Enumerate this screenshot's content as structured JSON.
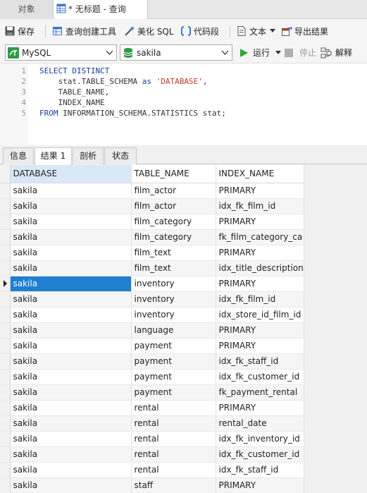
{
  "tabs": {
    "objects_label": "对象",
    "query_label": "* 无标题 - 查询"
  },
  "toolbar1": {
    "save_label": "保存",
    "query_builder_label": "查询创建工具",
    "beautify_label": "美化 SQL",
    "code_snippet_label": "代码段",
    "text_label": "文本",
    "export_label": "导出结果"
  },
  "toolbar2": {
    "connection": "MySQL",
    "database": "sakila",
    "run_label": "运行",
    "stop_label": "停止",
    "explain_label": "解释"
  },
  "editor": {
    "line_numbers": [
      "1",
      "2",
      "3",
      "4",
      "5"
    ]
  },
  "result_tabs": [
    "信息",
    "结果 1",
    "剖析",
    "状态"
  ],
  "grid": {
    "columns": [
      "DATABASE",
      "TABLE_NAME",
      "INDEX_NAME"
    ],
    "rows": [
      [
        "sakila",
        "film_actor",
        "PRIMARY"
      ],
      [
        "sakila",
        "film_actor",
        "idx_fk_film_id"
      ],
      [
        "sakila",
        "film_category",
        "PRIMARY"
      ],
      [
        "sakila",
        "film_category",
        "fk_film_category_ca"
      ],
      [
        "sakila",
        "film_text",
        "PRIMARY"
      ],
      [
        "sakila",
        "film_text",
        "idx_title_description"
      ],
      [
        "sakila",
        "inventory",
        "PRIMARY"
      ],
      [
        "sakila",
        "inventory",
        "idx_fk_film_id"
      ],
      [
        "sakila",
        "inventory",
        "idx_store_id_film_id"
      ],
      [
        "sakila",
        "language",
        "PRIMARY"
      ],
      [
        "sakila",
        "payment",
        "PRIMARY"
      ],
      [
        "sakila",
        "payment",
        "idx_fk_staff_id"
      ],
      [
        "sakila",
        "payment",
        "idx_fk_customer_id"
      ],
      [
        "sakila",
        "payment",
        "fk_payment_rental"
      ],
      [
        "sakila",
        "rental",
        "PRIMARY"
      ],
      [
        "sakila",
        "rental",
        "rental_date"
      ],
      [
        "sakila",
        "rental",
        "idx_fk_inventory_id"
      ],
      [
        "sakila",
        "rental",
        "idx_fk_customer_id"
      ],
      [
        "sakila",
        "rental",
        "idx_fk_staff_id"
      ],
      [
        "sakila",
        "staff",
        "PRIMARY"
      ]
    ]
  },
  "colors": {
    "selection": "#1f7fd0",
    "keyword": "#1a3ca8",
    "string": "#c0392b"
  }
}
